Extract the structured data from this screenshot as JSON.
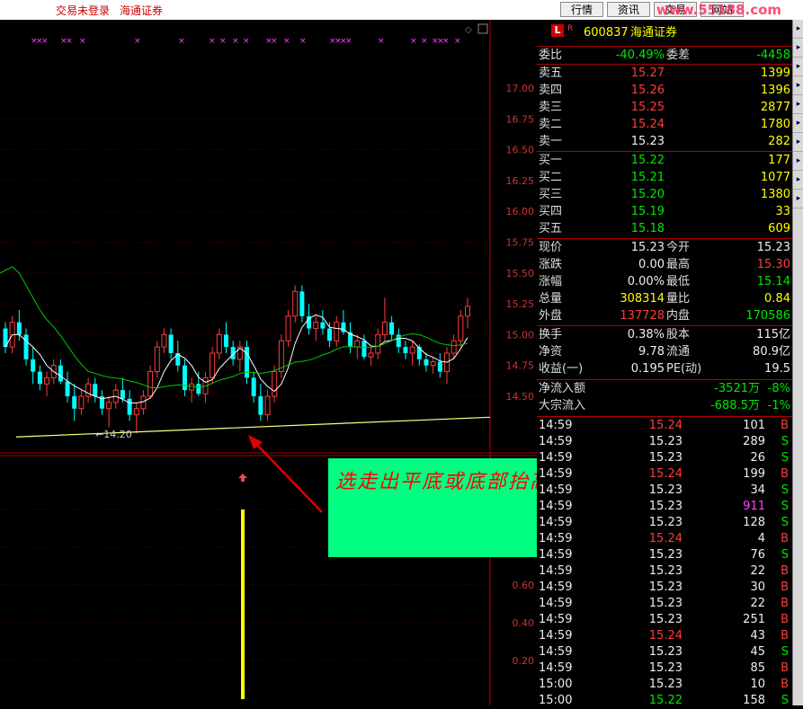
{
  "topbar": {
    "login_status": "交易未登录",
    "broker": "海通证券",
    "buttons": [
      "行情",
      "资讯",
      "交易",
      "网站"
    ],
    "watermark": "www.55188.com"
  },
  "chart": {
    "y_ticks_top": [
      "17.00",
      "16.75",
      "16.50",
      "16.25",
      "16.00",
      "15.75",
      "15.50",
      "15.25",
      "15.00",
      "14.75",
      "14.50"
    ],
    "y_ticks_bottom": [
      "0.60",
      "0.40",
      "0.20"
    ],
    "low_label": "←14.20",
    "colors": {
      "up": "#ff3c3c",
      "down": "#00ffff",
      "ma5": "#ffffff",
      "ma10": "#00cc00",
      "support": "#ffff80",
      "volume": "#ffff00"
    },
    "chart_data": {
      "type": "candlestick",
      "ylim": [
        14.25,
        17.25
      ],
      "candles": [
        [
          15.05,
          15.1,
          14.85,
          14.9
        ],
        [
          14.9,
          15.15,
          14.85,
          15.1
        ],
        [
          15.1,
          15.2,
          14.95,
          15.0
        ],
        [
          15.0,
          15.05,
          14.75,
          14.8
        ],
        [
          14.8,
          14.9,
          14.6,
          14.7
        ],
        [
          14.7,
          14.75,
          14.55,
          14.6
        ],
        [
          14.6,
          14.7,
          14.5,
          14.65
        ],
        [
          14.65,
          14.8,
          14.6,
          14.75
        ],
        [
          14.75,
          14.8,
          14.6,
          14.62
        ],
        [
          14.62,
          14.7,
          14.45,
          14.5
        ],
        [
          14.5,
          14.6,
          14.3,
          14.4
        ],
        [
          14.4,
          14.55,
          14.35,
          14.5
        ],
        [
          14.5,
          14.65,
          14.45,
          14.6
        ],
        [
          14.6,
          14.65,
          14.45,
          14.5
        ],
        [
          14.5,
          14.55,
          14.35,
          14.4
        ],
        [
          14.4,
          14.5,
          14.25,
          14.45
        ],
        [
          14.45,
          14.6,
          14.4,
          14.55
        ],
        [
          14.55,
          14.65,
          14.45,
          14.48
        ],
        [
          14.48,
          14.55,
          14.3,
          14.35
        ],
        [
          14.35,
          14.45,
          14.2,
          14.4
        ],
        [
          14.4,
          14.55,
          14.35,
          14.5
        ],
        [
          14.5,
          14.75,
          14.48,
          14.7
        ],
        [
          14.7,
          14.95,
          14.65,
          14.9
        ],
        [
          14.9,
          15.05,
          14.85,
          15.0
        ],
        [
          15.0,
          15.05,
          14.8,
          14.85
        ],
        [
          14.85,
          14.95,
          14.7,
          14.75
        ],
        [
          14.75,
          14.8,
          14.5,
          14.55
        ],
        [
          14.55,
          14.65,
          14.45,
          14.6
        ],
        [
          14.6,
          14.7,
          14.5,
          14.52
        ],
        [
          14.52,
          14.7,
          14.45,
          14.65
        ],
        [
          14.65,
          14.9,
          14.6,
          14.85
        ],
        [
          14.85,
          15.05,
          14.8,
          15.0
        ],
        [
          15.0,
          15.1,
          14.85,
          14.9
        ],
        [
          14.9,
          14.95,
          14.75,
          14.8
        ],
        [
          14.8,
          14.95,
          14.7,
          14.9
        ],
        [
          14.9,
          14.95,
          14.6,
          14.65
        ],
        [
          14.65,
          14.7,
          14.45,
          14.5
        ],
        [
          14.5,
          14.6,
          14.3,
          14.35
        ],
        [
          14.35,
          14.55,
          14.3,
          14.5
        ],
        [
          14.5,
          14.75,
          14.45,
          14.7
        ],
        [
          14.7,
          15.0,
          14.65,
          14.95
        ],
        [
          14.95,
          15.2,
          14.9,
          15.15
        ],
        [
          15.15,
          15.4,
          15.1,
          15.35
        ],
        [
          15.35,
          15.4,
          15.1,
          15.15
        ],
        [
          15.15,
          15.25,
          15.0,
          15.05
        ],
        [
          15.05,
          15.15,
          14.95,
          15.1
        ],
        [
          15.1,
          15.2,
          15.0,
          15.05
        ],
        [
          15.05,
          15.1,
          14.9,
          14.95
        ],
        [
          14.95,
          15.15,
          14.9,
          15.1
        ],
        [
          15.1,
          15.2,
          15.0,
          15.02
        ],
        [
          15.02,
          15.1,
          14.85,
          14.9
        ],
        [
          14.9,
          15.0,
          14.8,
          14.95
        ],
        [
          14.95,
          15.0,
          14.8,
          14.82
        ],
        [
          14.82,
          14.9,
          14.75,
          14.85
        ],
        [
          14.85,
          15.05,
          14.8,
          15.0
        ],
        [
          15.0,
          15.3,
          14.95,
          15.1
        ],
        [
          15.1,
          15.15,
          14.95,
          15.0
        ],
        [
          15.0,
          15.05,
          14.85,
          14.9
        ],
        [
          14.9,
          14.95,
          14.8,
          14.85
        ],
        [
          14.85,
          14.95,
          14.75,
          14.9
        ],
        [
          14.9,
          14.92,
          14.75,
          14.8
        ],
        [
          14.8,
          14.85,
          14.7,
          14.75
        ],
        [
          14.75,
          14.82,
          14.68,
          14.78
        ],
        [
          14.78,
          14.85,
          14.65,
          14.7
        ],
        [
          14.7,
          14.9,
          14.6,
          14.85
        ],
        [
          14.85,
          15.0,
          14.8,
          14.95
        ],
        [
          14.95,
          15.2,
          14.9,
          15.15
        ],
        [
          15.15,
          15.3,
          15.05,
          15.23
        ]
      ],
      "support_line": [
        14.17,
        14.33
      ]
    }
  },
  "quote": {
    "code": "600837",
    "name": "海通证券",
    "badge": "L",
    "weibi_label": "委比",
    "weibi_value": "-40.49%",
    "weicha_label": "委差",
    "weicha_value": "-4458",
    "asks": [
      {
        "label": "卖五",
        "price": "15.27",
        "vol": "1399"
      },
      {
        "label": "卖四",
        "price": "15.26",
        "vol": "1396"
      },
      {
        "label": "卖三",
        "price": "15.25",
        "vol": "2877"
      },
      {
        "label": "卖二",
        "price": "15.24",
        "vol": "1780"
      },
      {
        "label": "卖一",
        "price": "15.23",
        "vol": "282"
      }
    ],
    "bids": [
      {
        "label": "买一",
        "price": "15.22",
        "vol": "177"
      },
      {
        "label": "买二",
        "price": "15.21",
        "vol": "1077"
      },
      {
        "label": "买三",
        "price": "15.20",
        "vol": "1380"
      },
      {
        "label": "买四",
        "price": "15.19",
        "vol": "33"
      },
      {
        "label": "买五",
        "price": "15.18",
        "vol": "609"
      }
    ],
    "stats": [
      {
        "l1": "现价",
        "v1": "15.23",
        "c1": "wht",
        "l2": "今开",
        "v2": "15.23",
        "c2": "wht"
      },
      {
        "l1": "涨跌",
        "v1": "0.00",
        "c1": "wht",
        "l2": "最高",
        "v2": "15.30",
        "c2": "red"
      },
      {
        "l1": "涨幅",
        "v1": "0.00%",
        "c1": "wht",
        "l2": "最低",
        "v2": "15.14",
        "c2": "grn"
      },
      {
        "l1": "总量",
        "v1": "308314",
        "c1": "yel",
        "l2": "量比",
        "v2": "0.84",
        "c2": "yel"
      },
      {
        "l1": "外盘",
        "v1": "137728",
        "c1": "red",
        "l2": "内盘",
        "v2": "170586",
        "c2": "grn"
      }
    ],
    "stats2": [
      {
        "l1": "换手",
        "v1": "0.38%",
        "l2": "股本",
        "v2": "115亿"
      },
      {
        "l1": "净资",
        "v1": "9.78",
        "l2": "流通",
        "v2": "80.9亿"
      },
      {
        "l1": "收益(一)",
        "v1": "0.195",
        "l2": "PE(动)",
        "v2": "19.5"
      }
    ],
    "flow": [
      {
        "label": "净流入额",
        "value": "-3521万",
        "pct": "-8%"
      },
      {
        "label": "大宗流入",
        "value": "-688.5万",
        "pct": "-1%"
      }
    ],
    "ticks": [
      {
        "t": "14:59",
        "p": "15.24",
        "pc": "red",
        "v": "101",
        "vc": "wht",
        "d": "B"
      },
      {
        "t": "14:59",
        "p": "15.23",
        "pc": "wht",
        "v": "289",
        "vc": "wht",
        "d": "S"
      },
      {
        "t": "14:59",
        "p": "15.23",
        "pc": "wht",
        "v": "26",
        "vc": "wht",
        "d": "S"
      },
      {
        "t": "14:59",
        "p": "15.24",
        "pc": "red",
        "v": "199",
        "vc": "wht",
        "d": "B"
      },
      {
        "t": "14:59",
        "p": "15.23",
        "pc": "wht",
        "v": "34",
        "vc": "wht",
        "d": "S"
      },
      {
        "t": "14:59",
        "p": "15.23",
        "pc": "wht",
        "v": "911",
        "vc": "mag",
        "d": "S"
      },
      {
        "t": "14:59",
        "p": "15.23",
        "pc": "wht",
        "v": "128",
        "vc": "wht",
        "d": "S"
      },
      {
        "t": "14:59",
        "p": "15.24",
        "pc": "red",
        "v": "4",
        "vc": "wht",
        "d": "B"
      },
      {
        "t": "14:59",
        "p": "15.23",
        "pc": "wht",
        "v": "76",
        "vc": "wht",
        "d": "S"
      },
      {
        "t": "14:59",
        "p": "15.23",
        "pc": "wht",
        "v": "22",
        "vc": "wht",
        "d": "B"
      },
      {
        "t": "14:59",
        "p": "15.23",
        "pc": "wht",
        "v": "30",
        "vc": "wht",
        "d": "B"
      },
      {
        "t": "14:59",
        "p": "15.23",
        "pc": "wht",
        "v": "22",
        "vc": "wht",
        "d": "B"
      },
      {
        "t": "14:59",
        "p": "15.23",
        "pc": "wht",
        "v": "251",
        "vc": "wht",
        "d": "B"
      },
      {
        "t": "14:59",
        "p": "15.24",
        "pc": "red",
        "v": "43",
        "vc": "wht",
        "d": "B"
      },
      {
        "t": "14:59",
        "p": "15.23",
        "pc": "wht",
        "v": "45",
        "vc": "wht",
        "d": "S"
      },
      {
        "t": "14:59",
        "p": "15.23",
        "pc": "wht",
        "v": "85",
        "vc": "wht",
        "d": "B"
      },
      {
        "t": "15:00",
        "p": "15.23",
        "pc": "wht",
        "v": "10",
        "vc": "wht",
        "d": "B"
      },
      {
        "t": "15:00",
        "p": "15.22",
        "pc": "grn",
        "v": "158",
        "vc": "wht",
        "d": "S"
      }
    ]
  },
  "annotation": {
    "text": "选走出平底或底部抬高的票！"
  }
}
